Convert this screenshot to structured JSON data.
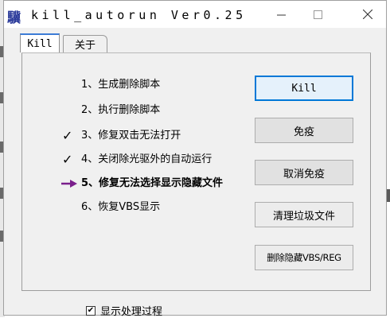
{
  "window": {
    "icon_glyph": "驥",
    "title": "kill_autorun Ver0.25",
    "controls": {
      "minimize": "—",
      "maximize": "☐",
      "close": "✕"
    }
  },
  "tabs": [
    {
      "label": "Kill",
      "active": true
    },
    {
      "label": "关于",
      "active": false
    }
  ],
  "steps": [
    {
      "label": "1、生成删除脚本",
      "mark": ""
    },
    {
      "label": "2、执行删除脚本",
      "mark": ""
    },
    {
      "label": "3、修复双击无法打开",
      "mark": "✓"
    },
    {
      "label": "4、关闭除光驱外的自动运行",
      "mark": "✓"
    },
    {
      "label": "5、修复无法选择显示隐藏文件",
      "mark": "arrow"
    },
    {
      "label": "6、恢复VBS显示",
      "mark": ""
    }
  ],
  "buttons": {
    "kill": "Kill",
    "immunize": "免疫",
    "cancel_immunize": "取消免疫",
    "clean_junk": "清理垃圾文件",
    "delete_hidden": "删除隐藏VBS/REG"
  },
  "show_process": {
    "label": "显示处理过程",
    "checked": true,
    "check_glyph": "✔"
  },
  "colors": {
    "arrow": "#7a1f8c",
    "focus_border": "#0078d7",
    "tab_accent": "#3c7bd6"
  }
}
